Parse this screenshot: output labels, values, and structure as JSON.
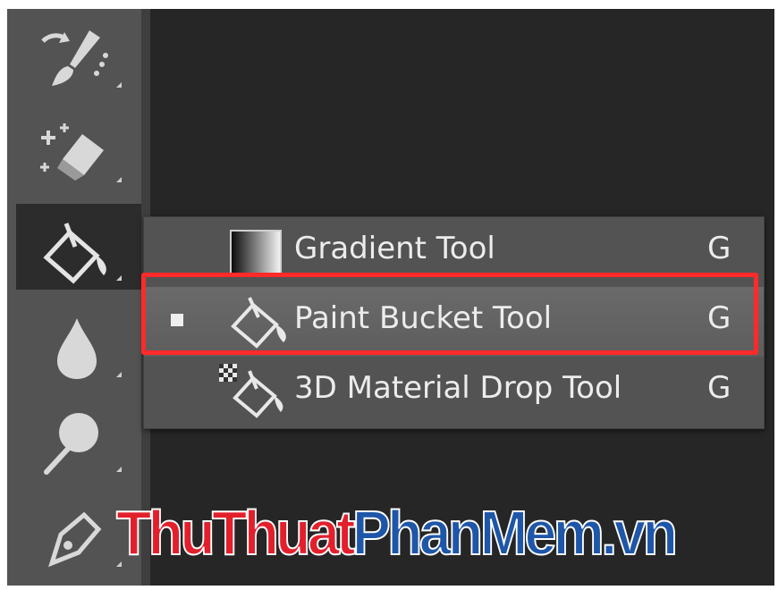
{
  "toolbar": {
    "tools": [
      {
        "name": "history-brush-tool",
        "icon": "history-brush-icon"
      },
      {
        "name": "background-eraser-tool",
        "icon": "eraser-icon"
      },
      {
        "name": "paint-bucket-tool",
        "icon": "paint-bucket-icon",
        "active": true
      },
      {
        "name": "blur-tool",
        "icon": "droplet-icon"
      },
      {
        "name": "dodge-tool",
        "icon": "dodge-icon"
      },
      {
        "name": "pen-tool",
        "icon": "pen-nib-icon"
      }
    ]
  },
  "flyout": {
    "items": [
      {
        "label": "Gradient Tool",
        "shortcut": "G",
        "icon": "gradient-icon",
        "selected": false
      },
      {
        "label": "Paint Bucket Tool",
        "shortcut": "G",
        "icon": "paint-bucket-icon",
        "selected": true
      },
      {
        "label": "3D Material Drop Tool",
        "shortcut": "G",
        "icon": "3d-material-drop-icon",
        "selected": false
      }
    ]
  },
  "watermark": {
    "part1": "ThuThuat",
    "part2": "PhanMem.vn"
  },
  "colors": {
    "highlight": "#ff2a2a",
    "panel": "#535353",
    "background": "#262626",
    "watermark_red": "#e2202c",
    "watermark_blue": "#1e56a8"
  }
}
